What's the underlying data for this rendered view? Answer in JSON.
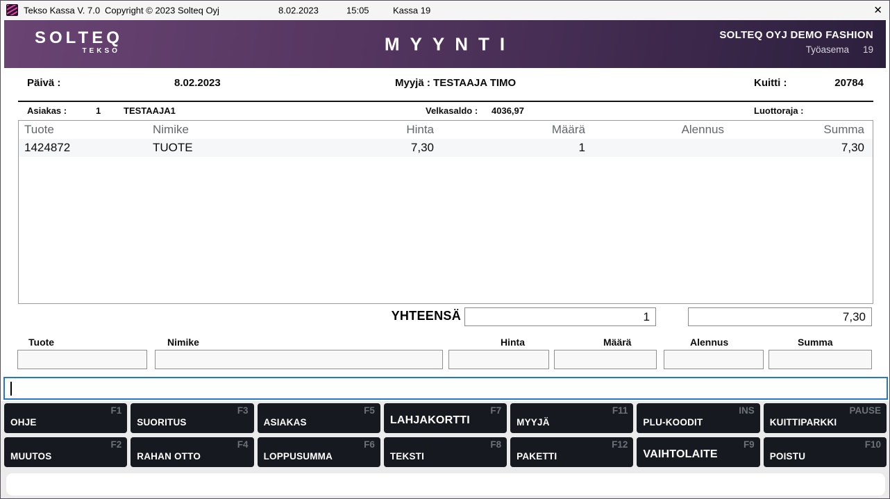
{
  "titlebar": {
    "app_title": "Tekso Kassa V. 7.0",
    "copyright": "Copyright © 2023 Solteq Oyj",
    "date": "8.02.2023",
    "time": "15:05",
    "register": "Kassa 19",
    "close_glyph": "✕"
  },
  "header": {
    "logo_primary": "SOLTEQ",
    "logo_secondary": "TEKSO",
    "screen_title": "MYYNTI",
    "store_name": "SOLTEQ OYJ DEMO FASHION",
    "workstation_label": "Työasema",
    "workstation_number": "19"
  },
  "info_bar": {
    "date_label": "Päivä :",
    "date_value": "8.02.2023",
    "cashier_label": "Myyjä :",
    "cashier_value": "TESTAAJA TIMO",
    "receipt_label": "Kuitti :",
    "receipt_number": "20784"
  },
  "customer_bar": {
    "customer_label": "Asiakas :",
    "customer_number": "1",
    "customer_name": "TESTAAJA1",
    "debt_label": "Velkasaldo :",
    "debt_value": "4036,97",
    "credit_limit_label": "Luottoraja :",
    "credit_limit_value": ""
  },
  "receipt_table": {
    "columns": [
      "Tuote",
      "Nimike",
      "Hinta",
      "Määrä",
      "Alennus",
      "Summa"
    ],
    "rows": [
      [
        "1424872",
        "TUOTE",
        "7,30",
        "1",
        "",
        "7,30"
      ]
    ]
  },
  "totals": {
    "label": "YHTEENSÄ",
    "total_quantity": "1",
    "total_sum": "7,30"
  },
  "entry": {
    "labels": [
      "Tuote",
      "Nimike",
      "Hinta",
      "Määrä",
      "Alennus",
      "Summa"
    ],
    "values": [
      "",
      "",
      "",
      "",
      "",
      ""
    ],
    "command_value": ""
  },
  "keypad": {
    "buttons": [
      {
        "label": "OHJE",
        "key": "F1"
      },
      {
        "label": "SUORITUS",
        "key": "F3"
      },
      {
        "label": "ASIAKAS",
        "key": "F5"
      },
      {
        "label": "LAHJAKORTTI",
        "key": "F7"
      },
      {
        "label": "MYYJÄ",
        "key": "F11"
      },
      {
        "label": "PLU-KOODIT",
        "key": "INS"
      },
      {
        "label": "KUITTIPARKKI",
        "key": "PAUSE"
      },
      {
        "label": "MUUTOS",
        "key": "F2"
      },
      {
        "label": "RAHAN OTTO",
        "key": "F4"
      },
      {
        "label": "LOPPUSUMMA",
        "key": "F6"
      },
      {
        "label": "TEKSTI",
        "key": "F8"
      },
      {
        "label": "PAKETTI",
        "key": "F12"
      },
      {
        "label": "VAIHTOLAITE",
        "key": "F9"
      },
      {
        "label": "POISTU",
        "key": "F10"
      }
    ]
  },
  "colors": {
    "header_gradient_start": "#6a4473",
    "header_gradient_end": "#2c1f3d",
    "button_bg": "#16191f",
    "button_key_text": "#6d7179",
    "focus_border": "#2178cd",
    "table_header_text": "#63666b",
    "row_alt_bg": "#f6f7f8"
  }
}
